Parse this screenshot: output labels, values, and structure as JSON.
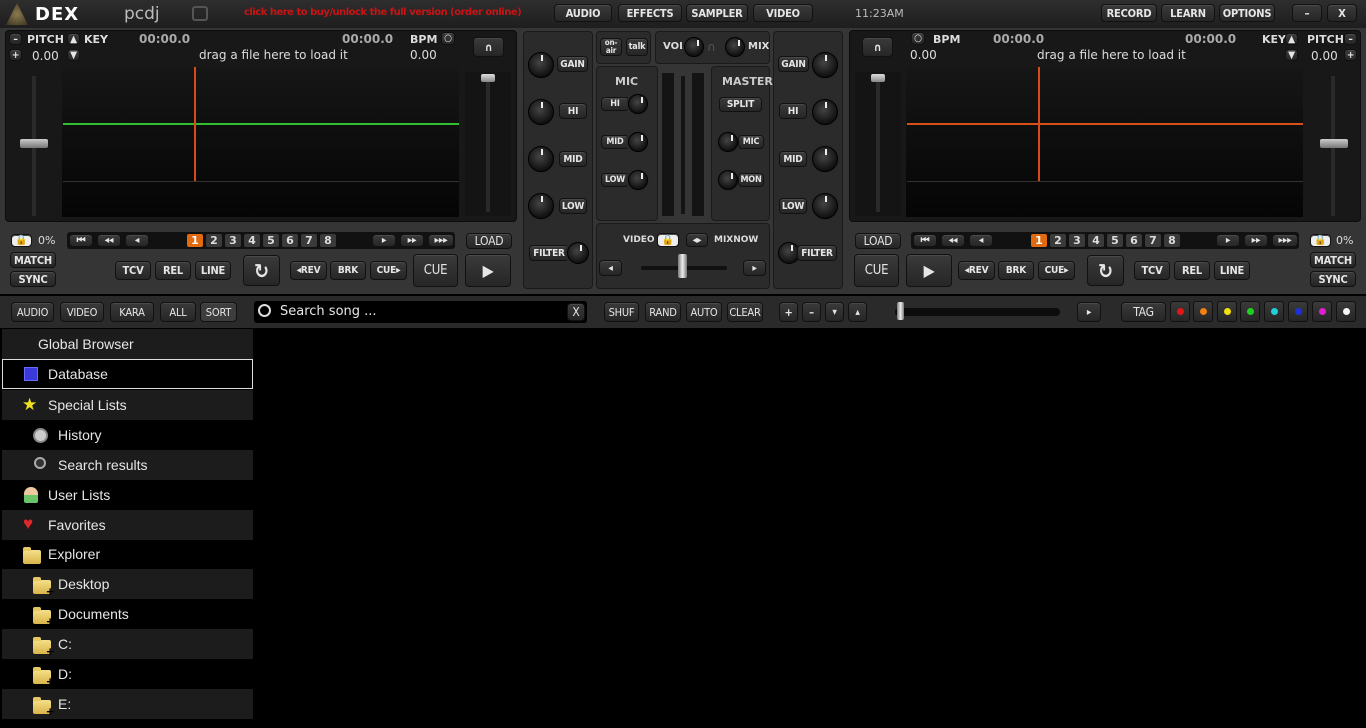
{
  "title_bar": {
    "logo": "DEX",
    "brand": "pcdj",
    "unlock_notice": "click here to buy/unlock the full version (order online)",
    "menu": [
      "AUDIO",
      "EFFECTS",
      "SAMPLER",
      "VIDEO"
    ],
    "clock": "11:23AM",
    "right_buttons": [
      "RECORD",
      "LEARN",
      "OPTIONS"
    ],
    "minimize": "–",
    "close": "X"
  },
  "deck_left": {
    "pitch_label": "PITCH",
    "pitch_value": "0.00",
    "key_label": "KEY",
    "time_elapsed": "00:00.0",
    "time_remaining": "00:00.0",
    "bpm_label": "BPM",
    "bpm_value": "0.00",
    "drop_hint": "drag a file here to load it",
    "lock_pct": "0%",
    "match": "MATCH",
    "sync": "SYNC",
    "hotcues": [
      "1",
      "2",
      "3",
      "4",
      "5",
      "6",
      "7",
      "8"
    ],
    "active_hotcue": "1",
    "load": "LOAD",
    "tcv": "TCV",
    "rel": "REL",
    "line": "LINE",
    "rev": "◂REV",
    "brk": "BRK",
    "cue_fwd": "CUE▸",
    "cue": "CUE",
    "play": "▶",
    "waveform_color": "#2fbf2f",
    "playhead_color": "#d84a1a"
  },
  "deck_right": {
    "pitch_label": "PITCH",
    "pitch_value": "0.00",
    "key_label": "KEY",
    "time_elapsed": "00:00.0",
    "time_remaining": "00:00.0",
    "bpm_label": "BPM",
    "bpm_value": "0.00",
    "drop_hint": "drag a file here to load it",
    "lock_pct": "0%",
    "match": "MATCH",
    "sync": "SYNC",
    "hotcues": [
      "1",
      "2",
      "3",
      "4",
      "5",
      "6",
      "7",
      "8"
    ],
    "active_hotcue": "1",
    "load": "LOAD",
    "tcv": "TCV",
    "rel": "REL",
    "line": "LINE",
    "rev": "◂REV",
    "brk": "BRK",
    "cue_fwd": "CUE▸",
    "cue": "CUE",
    "play": "▶",
    "waveform_color": "#d8501a",
    "playhead_color": "#d84a1a"
  },
  "mixer": {
    "gain": "GAIN",
    "hi": "HI",
    "mid": "MID",
    "low": "LOW",
    "filter": "FILTER",
    "on_air": "on-air",
    "talk": "talk",
    "vol": "VOL",
    "mix": "MIX",
    "mic_title": "MIC",
    "master_title": "MASTER",
    "split": "SPLIT",
    "mic_hi": "HI",
    "mic_mid": "MID",
    "mic_low": "LOW",
    "master_mic": "MIC",
    "master_mon": "MON",
    "video": "VIDEO",
    "mixnow": "MIXNOW"
  },
  "browser_toolbar": {
    "filters": [
      "AUDIO",
      "VIDEO",
      "KARA",
      "ALL",
      "SORT"
    ],
    "search_placeholder": "Search song ...",
    "search_clear": "X",
    "list_buttons": [
      "SHUF",
      "RAND",
      "AUTO",
      "CLEAR"
    ],
    "order_buttons": [
      "+",
      "–",
      "▾",
      "▴"
    ],
    "preview_play": "▸",
    "tag": "TAG",
    "tag_colors": [
      "#e01818",
      "#f08010",
      "#f0e010",
      "#20d020",
      "#20d0d8",
      "#2030d8",
      "#e020d0",
      "#f4f4f4"
    ]
  },
  "sidebar": {
    "items": [
      {
        "label": "Global Browser",
        "icon": "none"
      },
      {
        "label": "Database",
        "icon": "database-icon"
      },
      {
        "label": "Special Lists",
        "icon": "star-icon"
      },
      {
        "label": "History",
        "icon": "history-icon"
      },
      {
        "label": "Search results",
        "icon": "search-icon"
      },
      {
        "label": "User Lists",
        "icon": "user-icon"
      },
      {
        "label": "Favorites",
        "icon": "heart-icon"
      },
      {
        "label": "Explorer",
        "icon": "folder-icon"
      },
      {
        "label": "Desktop",
        "icon": "folder-plus-icon"
      },
      {
        "label": "Documents",
        "icon": "folder-plus-icon"
      },
      {
        "label": "C:",
        "icon": "folder-plus-icon"
      },
      {
        "label": "D:",
        "icon": "folder-plus-icon"
      },
      {
        "label": "E:",
        "icon": "folder-plus-icon"
      }
    ]
  }
}
